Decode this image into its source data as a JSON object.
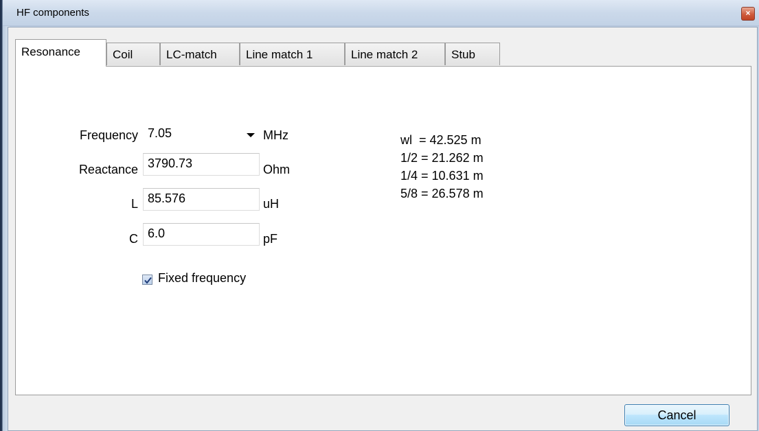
{
  "window": {
    "title": "HF components"
  },
  "tabs": [
    {
      "label": "Resonance",
      "active": true
    },
    {
      "label": "Coil",
      "active": false
    },
    {
      "label": "LC-match",
      "active": false
    },
    {
      "label": "Line match  1",
      "active": false
    },
    {
      "label": "Line match 2",
      "active": false
    },
    {
      "label": "Stub",
      "active": false
    }
  ],
  "form": {
    "frequency": {
      "label": "Frequency",
      "value": "7.05",
      "unit": "MHz"
    },
    "reactance": {
      "label": "Reactance",
      "value": "3790.73",
      "unit": "Ohm"
    },
    "inductance": {
      "label": "L",
      "value": "85.576",
      "unit": "uH"
    },
    "capacitance": {
      "label": "C",
      "value": "6.0",
      "unit": "pF"
    },
    "fixed_frequency": {
      "label": "Fixed frequency",
      "checked": true
    }
  },
  "results": [
    "wl  = 42.525 m",
    "1/2 = 21.262 m",
    "1/4 = 10.631 m",
    "5/8 = 26.578 m"
  ],
  "buttons": {
    "cancel": "Cancel"
  },
  "icons": {
    "close": "close-icon",
    "dropdown": "chevron-down-icon",
    "check": "checkmark-icon"
  }
}
